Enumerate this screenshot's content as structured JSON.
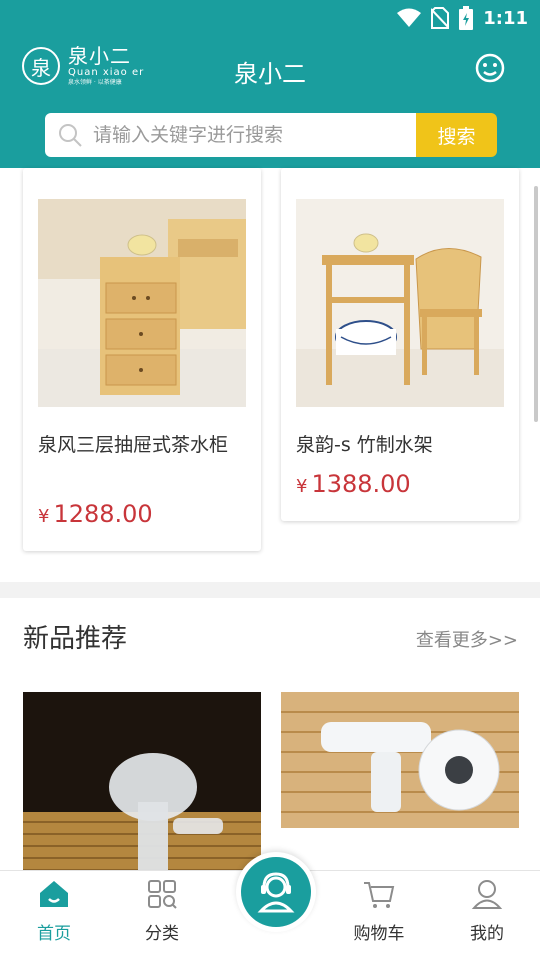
{
  "status": {
    "time": "1:11"
  },
  "header": {
    "logo_cn": "泉小二",
    "logo_en": "Quan xiao er",
    "logo_slogan": "泉水领鲜 · 以茶健康",
    "title": "泉小二",
    "search_placeholder": "请输入关键字进行搜索",
    "search_button": "搜索"
  },
  "products_top": [
    {
      "name": "泉风三层抽屉式茶水柜",
      "currency": "¥",
      "price": "1288.00"
    },
    {
      "name": "泉韵-s 竹制水架",
      "currency": "¥",
      "price": "1388.00"
    }
  ],
  "new_section": {
    "title": "新品推荐",
    "more": "查看更多>>"
  },
  "nav": {
    "home": "首页",
    "category": "分类",
    "cart": "购物车",
    "mine": "我的"
  },
  "colors": {
    "brand": "#1a9e9e",
    "accent": "#f0c419",
    "price": "#c8353a"
  }
}
